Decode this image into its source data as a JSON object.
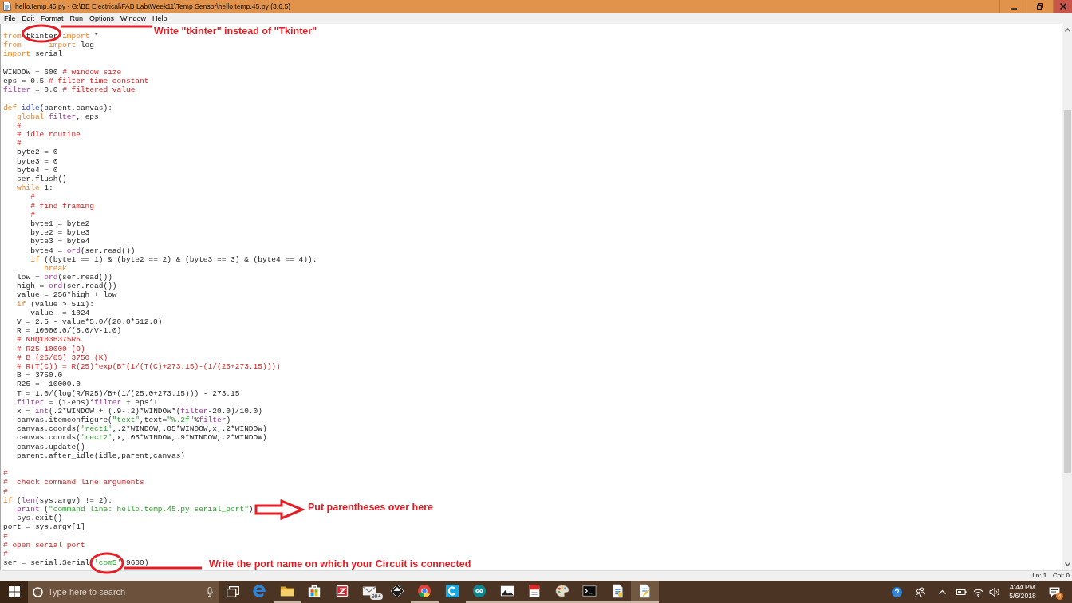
{
  "window": {
    "title": "hello.temp.45.py - G:\\BE Electrical\\FAB Lab\\Week11\\Temp Sensor\\hello.temp.45.py (3.6.5)"
  },
  "menu": [
    "File",
    "Edit",
    "Format",
    "Run",
    "Options",
    "Window",
    "Help"
  ],
  "editor": {
    "blocks": [
      {
        "lines": [
          {
            "tokens": [
              {
                "kind": "keyword",
                "text": "from"
              },
              {
                "kind": "plain",
                "text": " tkinter "
              },
              {
                "kind": "keyword",
                "text": "import"
              },
              {
                "kind": "plain",
                "text": " *"
              }
            ]
          },
          {
            "tokens": [
              {
                "kind": "keyword",
                "text": "from      import"
              },
              {
                "kind": "plain",
                "text": " log"
              }
            ]
          },
          {
            "tokens": [
              {
                "kind": "keyword",
                "text": "import"
              },
              {
                "kind": "plain",
                "text": " serial"
              }
            ]
          }
        ]
      },
      {
        "lines": [
          {
            "tokens": [
              {
                "kind": "plain",
                "text": "WINDOW = 600 "
              },
              {
                "kind": "comment",
                "text": "# window size"
              }
            ]
          },
          {
            "tokens": [
              {
                "kind": "plain",
                "text": "eps = 0.5 "
              },
              {
                "kind": "comment",
                "text": "# filter time constant"
              }
            ]
          },
          {
            "tokens": [
              {
                "kind": "builtin",
                "text": "filter"
              },
              {
                "kind": "plain",
                "text": " = 0.0 "
              },
              {
                "kind": "comment",
                "text": "# filtered value"
              }
            ]
          }
        ]
      },
      {
        "lines": [
          {
            "tokens": [
              {
                "kind": "keyword",
                "text": "def"
              },
              {
                "kind": "definition",
                "text": " idle"
              },
              {
                "kind": "plain",
                "text": "(parent,canvas):"
              }
            ],
            "children": [
              {
                "tokens": [
                  {
                    "kind": "keyword",
                    "text": "global"
                  },
                  {
                    "kind": "builtin",
                    "text": " filter"
                  },
                  {
                    "kind": "plain",
                    "text": ", eps"
                  }
                ]
              },
              {
                "tokens": [
                  {
                    "kind": "comment",
                    "text": "#"
                  }
                ]
              },
              {
                "tokens": [
                  {
                    "kind": "comment",
                    "text": "# idle routine"
                  }
                ]
              },
              {
                "tokens": [
                  {
                    "kind": "comment",
                    "text": "#"
                  }
                ]
              },
              {
                "tokens": [
                  {
                    "kind": "plain",
                    "text": "byte2 = 0"
                  }
                ]
              },
              {
                "tokens": [
                  {
                    "kind": "plain",
                    "text": "byte3 = 0"
                  }
                ]
              },
              {
                "tokens": [
                  {
                    "kind": "plain",
                    "text": "byte4 = 0"
                  }
                ]
              },
              {
                "tokens": [
                  {
                    "kind": "plain",
                    "text": "ser.flush()"
                  }
                ]
              },
              {
                "tokens": [
                  {
                    "kind": "keyword",
                    "text": "while"
                  },
                  {
                    "kind": "plain",
                    "text": " 1:"
                  }
                ],
                "children": [
                  {
                    "tokens": [
                      {
                        "kind": "comment",
                        "text": "#"
                      }
                    ]
                  },
                  {
                    "tokens": [
                      {
                        "kind": "comment",
                        "text": "# find framing"
                      }
                    ]
                  },
                  {
                    "tokens": [
                      {
                        "kind": "comment",
                        "text": "#"
                      }
                    ]
                  },
                  {
                    "tokens": [
                      {
                        "kind": "plain",
                        "text": "byte1 = byte2"
                      }
                    ]
                  },
                  {
                    "tokens": [
                      {
                        "kind": "plain",
                        "text": "byte2 = byte3"
                      }
                    ]
                  },
                  {
                    "tokens": [
                      {
                        "kind": "plain",
                        "text": "byte3 = byte4"
                      }
                    ]
                  },
                  {
                    "tokens": [
                      {
                        "kind": "plain",
                        "text": "byte4 = "
                      },
                      {
                        "kind": "builtin",
                        "text": "ord"
                      },
                      {
                        "kind": "plain",
                        "text": "(ser.read())"
                      }
                    ]
                  },
                  {
                    "tokens": [
                      {
                        "kind": "keyword",
                        "text": "if"
                      },
                      {
                        "kind": "plain",
                        "text": " ((byte1 == 1) & (byte2 == 2) & (byte3 == 3) & (byte4 == 4)):"
                      }
                    ],
                    "children": [
                      {
                        "tokens": [
                          {
                            "kind": "keyword",
                            "text": "break"
                          }
                        ]
                      }
                    ]
                  }
                ]
              },
              {
                "tokens": [
                  {
                    "kind": "plain",
                    "text": "low = "
                  },
                  {
                    "kind": "builtin",
                    "text": "ord"
                  },
                  {
                    "kind": "plain",
                    "text": "(ser.read())"
                  }
                ]
              },
              {
                "tokens": [
                  {
                    "kind": "plain",
                    "text": "high = "
                  },
                  {
                    "kind": "builtin",
                    "text": "ord"
                  },
                  {
                    "kind": "plain",
                    "text": "(ser.read())"
                  }
                ]
              },
              {
                "tokens": [
                  {
                    "kind": "plain",
                    "text": "value = 256*high + low"
                  }
                ]
              },
              {
                "tokens": [
                  {
                    "kind": "keyword",
                    "text": "if"
                  },
                  {
                    "kind": "plain",
                    "text": " (value > 511):"
                  }
                ],
                "children": [
                  {
                    "tokens": [
                      {
                        "kind": "plain",
                        "text": "value -= 1024"
                      }
                    ]
                  }
                ]
              },
              {
                "tokens": [
                  {
                    "kind": "plain",
                    "text": "V = 2.5 - value*5.0/(20.0*512.0)"
                  }
                ]
              },
              {
                "tokens": [
                  {
                    "kind": "plain",
                    "text": "R = 10000.0/(5.0/V-1.0)"
                  }
                ]
              },
              {
                "tokens": [
                  {
                    "kind": "comment",
                    "text": "# NHQ103B375R5"
                  }
                ]
              },
              {
                "tokens": [
                  {
                    "kind": "comment",
                    "text": "# R25 10000 (O)"
                  }
                ]
              },
              {
                "tokens": [
                  {
                    "kind": "comment",
                    "text": "# B (25/85) 3750 (K)"
                  }
                ]
              },
              {
                "tokens": [
                  {
                    "kind": "comment",
                    "text": "# R(T(C)) = R(25)*exp(B*(1/(T(C)+273.15)-(1/(25+273.15))))"
                  }
                ]
              },
              {
                "tokens": [
                  {
                    "kind": "plain",
                    "text": "B = 3750.0"
                  }
                ]
              },
              {
                "tokens": [
                  {
                    "kind": "plain",
                    "text": "R25 =  10000.0"
                  }
                ]
              },
              {
                "tokens": [
                  {
                    "kind": "plain",
                    "text": "T = 1.0/(log(R/R25)/B+(1/(25.0+273.15))) - 273.15"
                  }
                ]
              },
              {
                "tokens": [
                  {
                    "kind": "builtin",
                    "text": "filter"
                  },
                  {
                    "kind": "plain",
                    "text": " = (1-eps)*"
                  },
                  {
                    "kind": "builtin",
                    "text": "filter"
                  },
                  {
                    "kind": "plain",
                    "text": " + eps*T"
                  }
                ]
              },
              {
                "tokens": [
                  {
                    "kind": "plain",
                    "text": "x = "
                  },
                  {
                    "kind": "builtin",
                    "text": "int"
                  },
                  {
                    "kind": "plain",
                    "text": "(.2*WINDOW + (.9-.2)*WINDOW*("
                  },
                  {
                    "kind": "builtin",
                    "text": "filter"
                  },
                  {
                    "kind": "plain",
                    "text": "-20.0)/10.0)"
                  }
                ]
              },
              {
                "tokens": [
                  {
                    "kind": "plain",
                    "text": "canvas.itemconfigure("
                  },
                  {
                    "kind": "string",
                    "text": "\"text\""
                  },
                  {
                    "kind": "plain",
                    "text": ",text="
                  },
                  {
                    "kind": "string",
                    "text": "\"%.2f\""
                  },
                  {
                    "kind": "plain",
                    "text": "%"
                  },
                  {
                    "kind": "builtin",
                    "text": "filter"
                  },
                  {
                    "kind": "plain",
                    "text": ")"
                  }
                ]
              },
              {
                "tokens": [
                  {
                    "kind": "plain",
                    "text": "canvas.coords("
                  },
                  {
                    "kind": "string",
                    "text": "'rect1'"
                  },
                  {
                    "kind": "plain",
                    "text": ",.2*WINDOW,.05*WINDOW,x,.2*WINDOW)"
                  }
                ]
              },
              {
                "tokens": [
                  {
                    "kind": "plain",
                    "text": "canvas.coords("
                  },
                  {
                    "kind": "string",
                    "text": "'rect2'"
                  },
                  {
                    "kind": "plain",
                    "text": ",x,.05*WINDOW,.9*WINDOW,.2*WINDOW)"
                  }
                ]
              },
              {
                "tokens": [
                  {
                    "kind": "plain",
                    "text": "canvas.update()"
                  }
                ]
              },
              {
                "tokens": [
                  {
                    "kind": "plain",
                    "text": "parent.after_idle(idle,parent,canvas)"
                  }
                ]
              }
            ]
          }
        ]
      },
      {
        "lines": [
          {
            "tokens": [
              {
                "kind": "comment",
                "text": "#"
              }
            ]
          },
          {
            "tokens": [
              {
                "kind": "comment",
                "text": "#  check command line arguments"
              }
            ]
          },
          {
            "tokens": [
              {
                "kind": "comment",
                "text": "#"
              }
            ]
          },
          {
            "tokens": [
              {
                "kind": "keyword",
                "text": "if"
              },
              {
                "kind": "plain",
                "text": " ("
              },
              {
                "kind": "builtin",
                "text": "len"
              },
              {
                "kind": "plain",
                "text": "(sys.argv) != 2):"
              }
            ],
            "children": [
              {
                "tokens": [
                  {
                    "kind": "builtin",
                    "text": "print"
                  },
                  {
                    "kind": "plain",
                    "text": " ("
                  },
                  {
                    "kind": "string",
                    "text": "\"command line: hello.temp.45.py serial_port\""
                  },
                  {
                    "kind": "plain",
                    "text": ")"
                  }
                ]
              },
              {
                "tokens": [
                  {
                    "kind": "plain",
                    "text": "sys.exit()"
                  }
                ]
              }
            ]
          },
          {
            "tokens": [
              {
                "kind": "plain",
                "text": "port = sys.argv[1]"
              }
            ]
          },
          {
            "tokens": [
              {
                "kind": "comment",
                "text": "#"
              }
            ]
          },
          {
            "tokens": [
              {
                "kind": "comment",
                "text": "# open serial port"
              }
            ]
          },
          {
            "tokens": [
              {
                "kind": "comment",
                "text": "#"
              }
            ]
          },
          {
            "tokens": [
              {
                "kind": "plain",
                "text": "ser = serial.Serial "
              },
              {
                "kind": "string",
                "text": "'com5'"
              },
              {
                "kind": "plain",
                "text": " 9600)"
              }
            ]
          }
        ]
      }
    ]
  },
  "annotations": [
    {
      "kind": "circle",
      "text": "Write \"tkinter\" instead of \"Tkinter\""
    },
    {
      "kind": "arrow",
      "text": "Put parentheses over here"
    },
    {
      "kind": "circle",
      "text": "Write the port name on which your Circuit is connected"
    }
  ],
  "status_bar": {
    "line": "Ln: 1",
    "column": "Col: 0"
  },
  "taskbar": {
    "search": {
      "placeholder": "Type here to search"
    },
    "apps": [
      {
        "kind": "e-logo",
        "running": false,
        "selected": false
      },
      {
        "kind": "folder",
        "running": true,
        "selected": false
      },
      {
        "kind": "bag",
        "running": false,
        "selected": false
      },
      {
        "kind": "z-tile",
        "running": false,
        "selected": false
      },
      {
        "kind": "envelope",
        "running": false,
        "selected": false,
        "badge": "99+"
      },
      {
        "kind": "diamond",
        "running": false,
        "selected": false
      },
      {
        "kind": "round-logo",
        "running": true,
        "selected": false
      },
      {
        "kind": "c-tile",
        "running": false,
        "selected": false
      },
      {
        "kind": "infinity",
        "running": true,
        "selected": false
      },
      {
        "kind": "picture",
        "running": true,
        "selected": false
      },
      {
        "kind": "doc",
        "running": true,
        "selected": false
      },
      {
        "kind": "palette",
        "running": true,
        "selected": false
      },
      {
        "kind": "terminal",
        "running": true,
        "selected": false
      },
      {
        "kind": "script",
        "running": true,
        "selected": false
      },
      {
        "kind": "feather-script",
        "running": true,
        "selected": true
      }
    ],
    "clock": {
      "time": "4:44 PM",
      "date": "5/6/2018"
    },
    "notification_count": "4"
  }
}
